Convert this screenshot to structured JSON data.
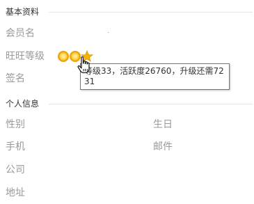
{
  "basic_info": {
    "title": "基本资料",
    "fields": {
      "member_name": {
        "label": "会员名",
        "value": ""
      },
      "wangwang_level": {
        "label": "旺旺等级",
        "badges": [
          "sun",
          "sun",
          "star"
        ]
      },
      "signature": {
        "label": "签名",
        "value": ""
      }
    }
  },
  "personal_info": {
    "title": "个人信息",
    "fields": {
      "gender": {
        "label": "性别",
        "value": ""
      },
      "birthday": {
        "label": "生日",
        "value": ""
      },
      "phone": {
        "label": "手机",
        "value": ""
      },
      "email": {
        "label": "邮件",
        "value": ""
      },
      "company": {
        "label": "公司",
        "value": ""
      },
      "address": {
        "label": "地址",
        "value": ""
      }
    }
  },
  "tooltip": {
    "text": "等级33，活跃度26760，升级还需7231"
  },
  "colors": {
    "label": "#999999",
    "header": "#333333",
    "divider": "#e6e6e6",
    "sun": "#f0a30a",
    "star": "#f5b400"
  }
}
